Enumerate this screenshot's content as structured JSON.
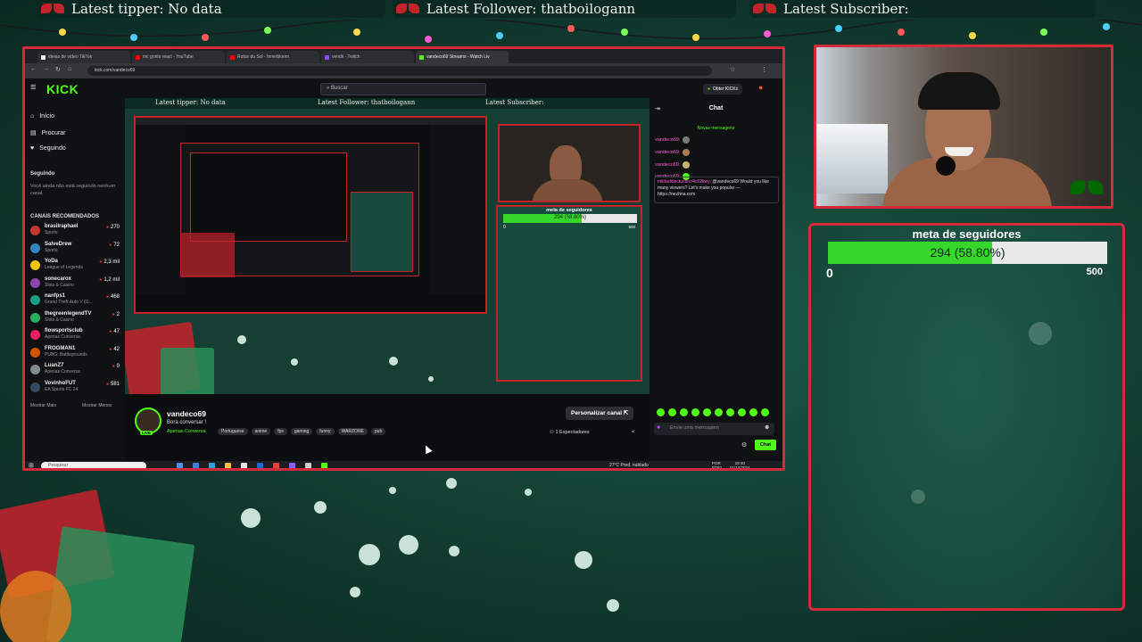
{
  "overlay": {
    "tipper_label": "Latest tipper: No data",
    "follower_label": "Latest Follower: thatboilogann",
    "subscriber_label": "Latest Subscriber:"
  },
  "browser": {
    "tabs": [
      {
        "label": "ideias de vídeo TikTok",
        "color": "#ffffff"
      },
      {
        "label": "mc gorila react - YouTube",
        "color": "#ff0000"
      },
      {
        "label": "Rufus du Sol - Innerbloom",
        "color": "#ff0000"
      },
      {
        "label": "vendii - Twitch",
        "color": "#9146ff"
      },
      {
        "label": "vandeco69 Streams - Watch Liv",
        "color": "#53fc18"
      }
    ],
    "url": "kick.com/vandeco69"
  },
  "kick": {
    "logo": "KICK",
    "search_placeholder": "Buscar",
    "get_kicks": "Obter KICKs",
    "nav": {
      "home": "Início",
      "browse": "Procurar",
      "following": "Seguindo"
    },
    "following_section": "Seguindo",
    "following_note": "Você ainda não está seguindo nenhum canal.",
    "recommended_title": "CANAIS RECOMENDADOS",
    "recommended": [
      {
        "name": "brasilraphael",
        "category": "Sports",
        "viewers": "270",
        "color": "#c0392b"
      },
      {
        "name": "SalveDrew",
        "category": "Sports",
        "viewers": "72",
        "color": "#2e86c1"
      },
      {
        "name": "YoDa",
        "category": "League of Legends",
        "viewers": "2,3 mil",
        "color": "#f1c40f"
      },
      {
        "name": "sonecarox",
        "category": "Slots & Casino",
        "viewers": "1,2 mil",
        "color": "#8e44ad"
      },
      {
        "name": "nanfps1",
        "category": "Grand Theft Auto V (G...",
        "viewers": "468",
        "color": "#16a085"
      },
      {
        "name": "thegreenlegendTV",
        "category": "Slots & Casino",
        "viewers": "2",
        "color": "#27ae60"
      },
      {
        "name": "flowsportsclub",
        "category": "Apenas Conversa",
        "viewers": "47",
        "color": "#e91e63"
      },
      {
        "name": "FROGMAN1",
        "category": "PUBG: Battlegrounds",
        "viewers": "42",
        "color": "#d35400"
      },
      {
        "name": "LuanZ7",
        "category": "Apenas Conversa",
        "viewers": "0",
        "color": "#7f8c8d"
      },
      {
        "name": "VovinhoFUT",
        "category": "EA Sports FC 24",
        "viewers": "581",
        "color": "#34495e"
      }
    ],
    "show_more": "Mostrar Mais",
    "show_less": "Mostrar Menos",
    "channel": {
      "name": "vandeco69",
      "title": "Bora conversar !",
      "category": "Apenas Conversa",
      "tags": [
        "Portuguese",
        "anime",
        "fps",
        "gaming",
        "funny",
        "WARZONE",
        "pub"
      ],
      "customize": "Personalizar canal",
      "viewers": "1 Espectadores",
      "live_badge": "LIVE"
    },
    "chat": {
      "title": "Chat",
      "new_messages": "Novas mensagens",
      "messages": [
        {
          "user": "vandeco69:"
        },
        {
          "user": "vandeco69:"
        },
        {
          "user": "vandeco69:"
        },
        {
          "user": "vandeco69:"
        }
      ],
      "reply_user": "mildaddiectucbrcr4c02kwy:",
      "reply_mention": "@vandeco69",
      "reply_text": "Would you like many viewers? Let's make you popular — https://nezhna.com",
      "input_placeholder": "Envie uma mensagem",
      "send": "Chat"
    }
  },
  "mirror": {
    "tipper": "Latest tipper: No data",
    "follower": "Latest Follower: thatboilogann",
    "subscriber": "Latest Subscriber:",
    "goal_title": "meta de seguidores",
    "goal_text": "294 (58.80%)",
    "goal_min": "0",
    "goal_max": "500"
  },
  "taskbar": {
    "search": "Pesquisar",
    "weather": "27°C  Pred. nublado",
    "lang": "POR",
    "lang2": "PTB2",
    "time": "19:40",
    "date": "01/12/2024"
  },
  "goal": {
    "title": "meta de seguidores",
    "current": 294,
    "target": 500,
    "fraction": 0.588,
    "text": "294 (58.80%)",
    "min_label": "0",
    "max_label": "500",
    "bar_color": "#36d62b"
  }
}
